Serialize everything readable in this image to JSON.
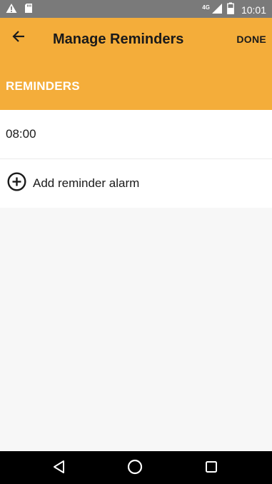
{
  "status_bar": {
    "network_label": "4G",
    "time": "10:01",
    "left_icons": [
      "warning-icon",
      "sd-card-icon"
    ],
    "right_icons": [
      "signal-icon",
      "battery-icon"
    ]
  },
  "app_bar": {
    "title": "Manage Reminders",
    "done_label": "DONE",
    "section_header": "REMINDERS",
    "color": "#f4ad3a",
    "back_icon": "arrow-back-icon"
  },
  "reminders": [
    {
      "time": "08:00"
    }
  ],
  "add_reminder": {
    "label": "Add reminder alarm",
    "icon": "add-circle-icon"
  },
  "nav_bar": {
    "icons": [
      "back-triangle-icon",
      "home-circle-icon",
      "recents-square-icon"
    ]
  }
}
